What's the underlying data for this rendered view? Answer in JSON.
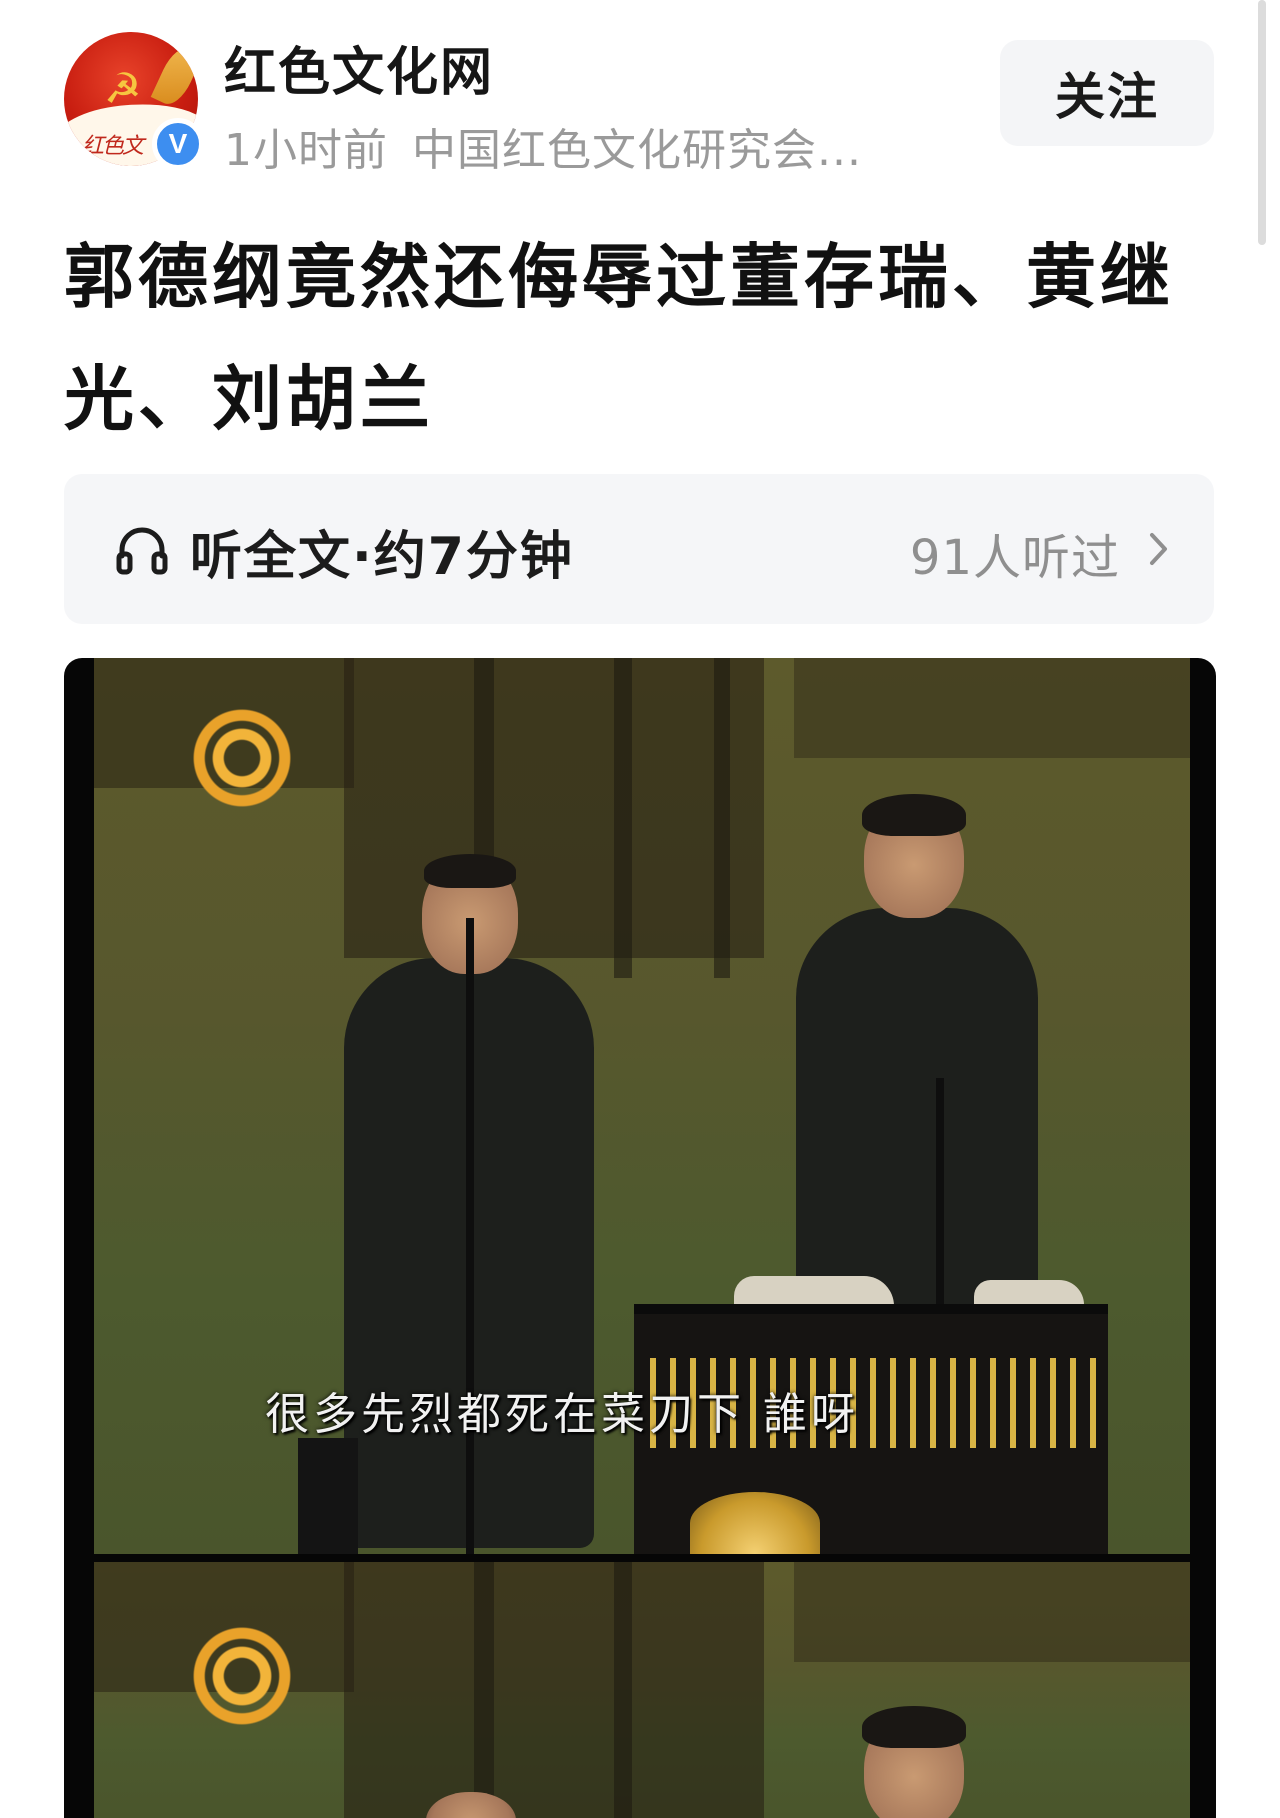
{
  "author": {
    "name": "红色文化网",
    "avatar_script": "红色文",
    "verified_badge": "V",
    "time": "1小时前",
    "source": "中国红色文化研究会..."
  },
  "follow_label": "关注",
  "article": {
    "title": "郭德纲竟然还侮辱过董存瑞、黄继光、刘胡兰"
  },
  "listen": {
    "label": "听全文·约7分钟",
    "count": "91人听过",
    "icon": "headphone-icon"
  },
  "video": {
    "subtitle": "很多先烈都死在菜刀下 誰呀",
    "logo_icon": "phoenix-logo"
  },
  "colors": {
    "background": "#ffffff",
    "muted_text": "#9a9a9a",
    "verified_blue": "#3d8ef0",
    "panel_bg": "#f5f6f8"
  }
}
